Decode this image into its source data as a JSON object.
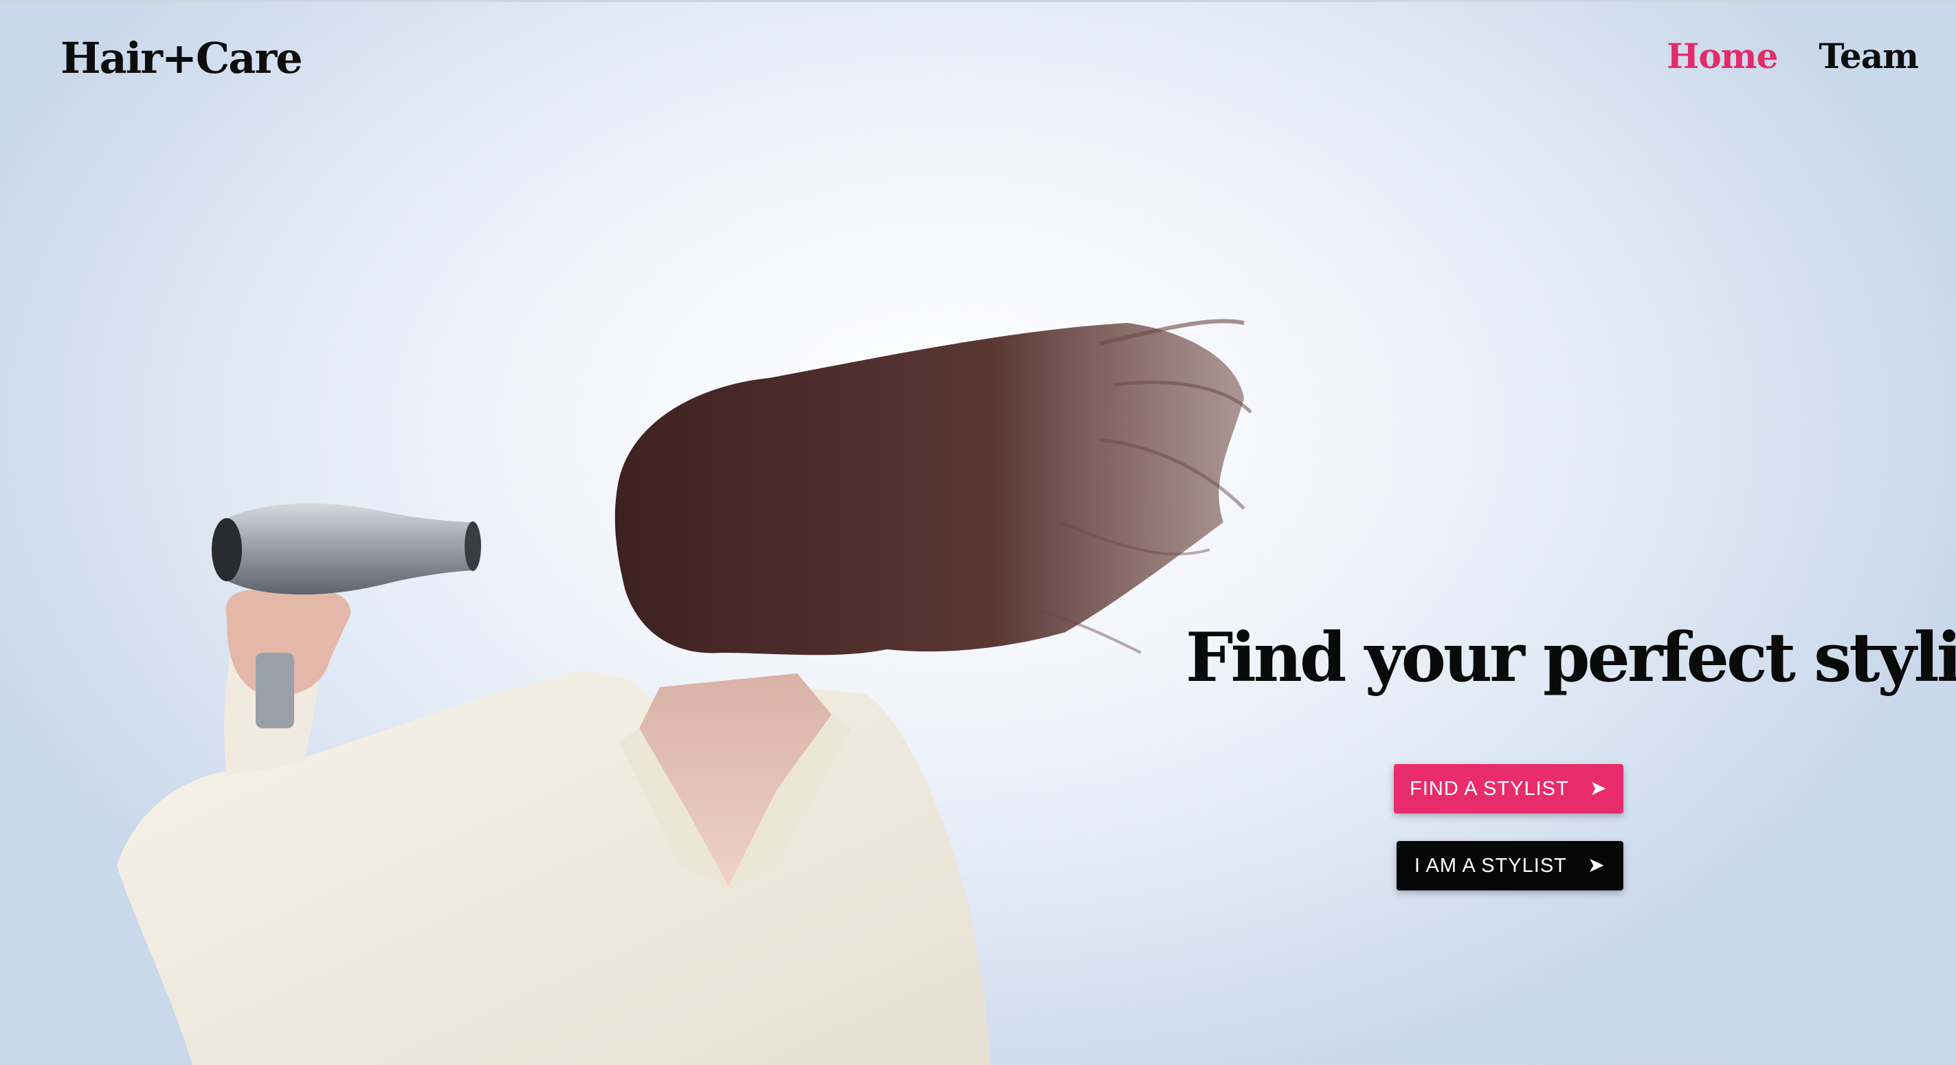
{
  "header": {
    "brand": "Hair+Care",
    "nav": [
      {
        "label": "Home",
        "active": true
      },
      {
        "label": "Team",
        "active": false
      }
    ]
  },
  "hero": {
    "title": "Find your perfect stylist",
    "find_button": {
      "label": "FIND A STYLIST",
      "icon": "arrow-right-icon"
    },
    "stylist_button": {
      "label": "I AM A STYLIST",
      "icon": "arrow-right-icon"
    }
  },
  "colors": {
    "accent": "#e12c6a",
    "dark": "#070707",
    "text": "#0d0d0d"
  }
}
